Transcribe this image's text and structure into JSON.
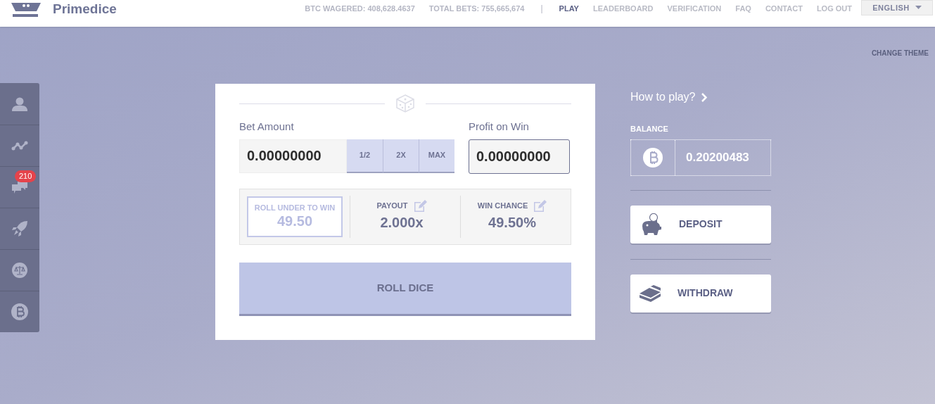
{
  "header": {
    "logo_text": "Primedice",
    "stats": [
      {
        "label": "BTC WAGERED:",
        "value": "408,628.4637"
      },
      {
        "label": "TOTAL BETS:",
        "value": "755,665,674"
      }
    ],
    "separator": "|",
    "nav": [
      {
        "label": "PLAY",
        "selected": true
      },
      {
        "label": "LEADERBOARD",
        "selected": false
      },
      {
        "label": "VERIFICATION",
        "selected": false
      },
      {
        "label": "FAQ",
        "selected": false
      },
      {
        "label": "CONTACT",
        "selected": false
      },
      {
        "label": "LOG OUT",
        "selected": false
      }
    ],
    "language": "ENGLISH"
  },
  "change_theme": "CHANGE THEME",
  "sidebar": {
    "items": [
      {
        "kind": "user"
      },
      {
        "kind": "stats"
      },
      {
        "kind": "chat",
        "badge": "210"
      },
      {
        "kind": "rocket"
      },
      {
        "kind": "scales"
      },
      {
        "kind": "bitcoin"
      }
    ]
  },
  "bet": {
    "label": "Bet Amount",
    "value": "0.00000000",
    "buttons": [
      "1/2",
      "2X",
      "MAX"
    ]
  },
  "profit": {
    "label": "Profit on Win",
    "value": "0.00000000"
  },
  "stats": [
    {
      "kind": "target",
      "label": "ROLL UNDER TO WIN",
      "value": "49.50"
    },
    {
      "kind": "editable",
      "label": "PAYOUT",
      "value": "2.000x"
    },
    {
      "kind": "editable",
      "label": "WIN CHANCE",
      "value": "49.50%"
    }
  ],
  "roll_button": "ROLL DICE",
  "how_to_play": "How to play?",
  "balance": {
    "label": "BALANCE",
    "value": "0.20200483"
  },
  "actions": [
    {
      "kind": "deposit",
      "label": "DEPOSIT"
    },
    {
      "kind": "withdraw",
      "label": "WITHDRAW"
    }
  ]
}
